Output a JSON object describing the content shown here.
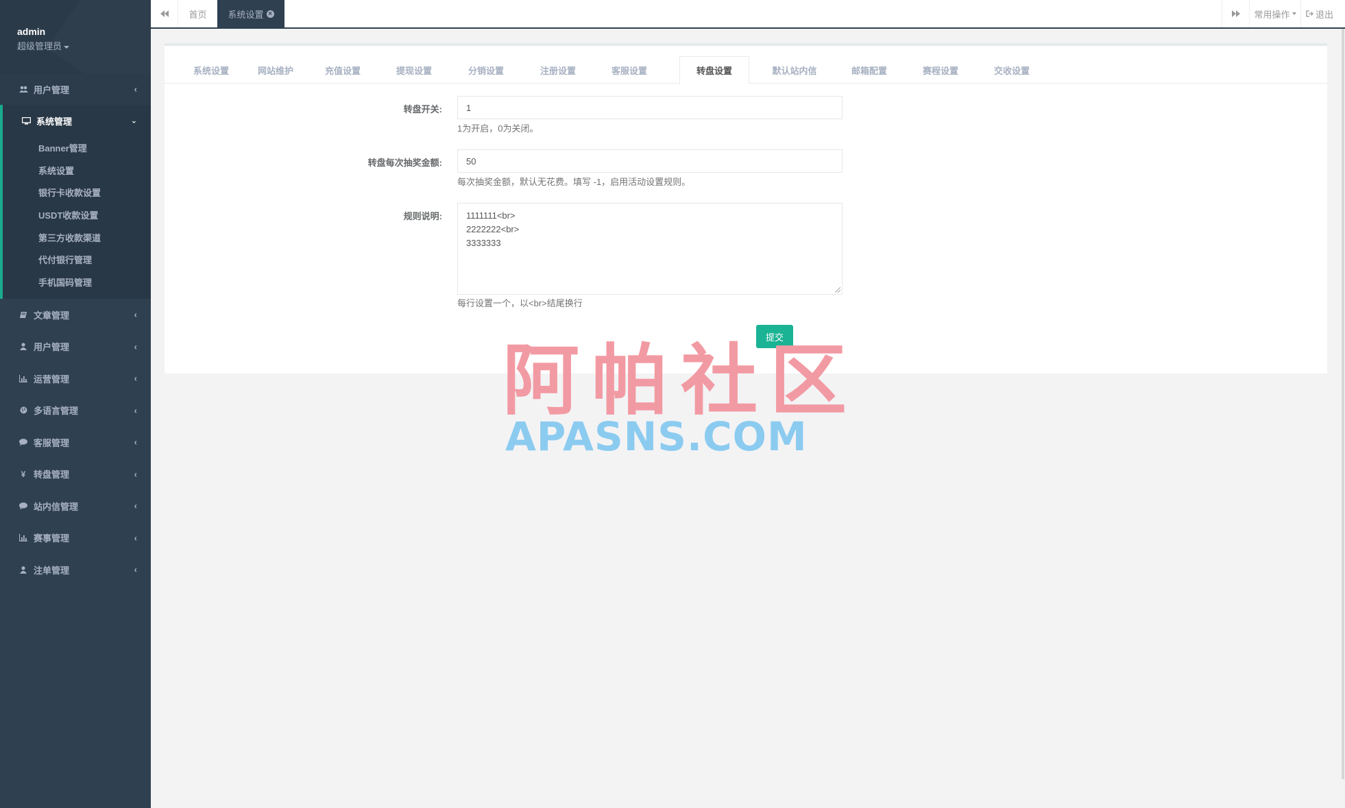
{
  "profile": {
    "username": "admin",
    "role": "超级管理员"
  },
  "sidebar": {
    "first": {
      "label": "用户管理",
      "icon": "users-icon"
    },
    "active_group": {
      "label": "系统管理",
      "icon": "desktop-icon",
      "items": [
        "Banner管理",
        "系统设置",
        "银行卡收款设置",
        "USDT收款设置",
        "第三方收款渠道",
        "代付银行管理",
        "手机国码管理"
      ]
    },
    "rest": [
      {
        "label": "文章管理",
        "icon": "book-icon"
      },
      {
        "label": "用户管理",
        "icon": "user-icon"
      },
      {
        "label": "运营管理",
        "icon": "bar-chart-icon"
      },
      {
        "label": "多语言管理",
        "icon": "globe-icon"
      },
      {
        "label": "客服管理",
        "icon": "comment-icon"
      },
      {
        "label": "转盘管理",
        "icon": "yen-icon"
      },
      {
        "label": "站内信管理",
        "icon": "comment-icon"
      },
      {
        "label": "赛事管理",
        "icon": "bar-chart-icon"
      },
      {
        "label": "注单管理",
        "icon": "user-icon"
      }
    ]
  },
  "topbar": {
    "home_tab": "首页",
    "active_tab": "系统设置",
    "ops_label": "常用操作",
    "exit_label": "退出"
  },
  "settings_tabs": [
    "系统设置",
    "网站维护",
    "充值设置",
    "提现设置",
    "分销设置",
    "注册设置",
    "客服设置",
    "转盘设置",
    "默认站内信",
    "邮箱配置",
    "赛程设置",
    "交收设置"
  ],
  "active_settings_tab": "转盘设置",
  "form": {
    "switch_label": "转盘开关:",
    "switch_value": "1",
    "switch_help": "1为开启，0为关闭。",
    "amount_label": "转盘每次抽奖金额:",
    "amount_value": "50",
    "amount_help": "每次抽奖金额，默认无花费。填写 -1，启用活动设置规则。",
    "rules_label": "规则说明:",
    "rules_value": "1111111<br>\n2222222<br>\n3333333",
    "rules_help": "每行设置一个，以<br>结尾换行",
    "submit_label": "提交"
  },
  "watermark": {
    "cn": "阿帕社区",
    "en": "APASNS.COM"
  },
  "colors": {
    "sidebar": "#2f4050",
    "accent": "#1ab394",
    "active_border": "#19aa8d"
  }
}
